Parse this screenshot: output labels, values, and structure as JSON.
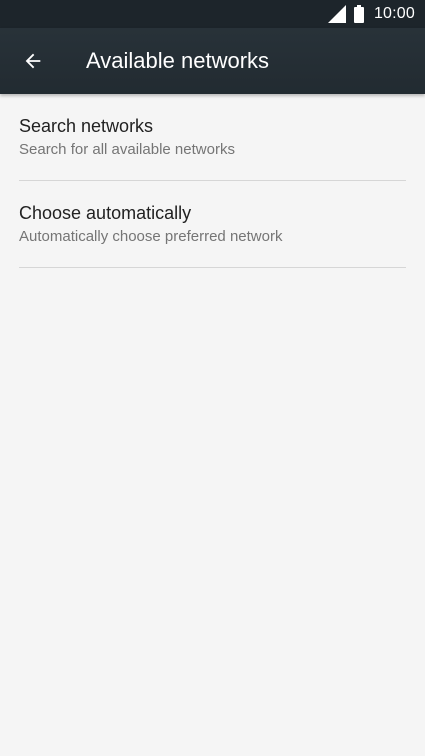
{
  "status_bar": {
    "time": "10:00",
    "icons": [
      "signal-icon",
      "battery-icon"
    ]
  },
  "toolbar": {
    "back_icon": "arrow-left-icon",
    "title": "Available networks"
  },
  "list": {
    "items": [
      {
        "title": "Search networks",
        "subtitle": "Search for all available networks"
      },
      {
        "title": "Choose automatically",
        "subtitle": "Automatically choose preferred network"
      }
    ]
  },
  "colors": {
    "status_bar_bg": "#1d252b",
    "toolbar_bg": "#283239",
    "page_bg": "#f5f5f5",
    "divider": "#d6d6d6"
  }
}
